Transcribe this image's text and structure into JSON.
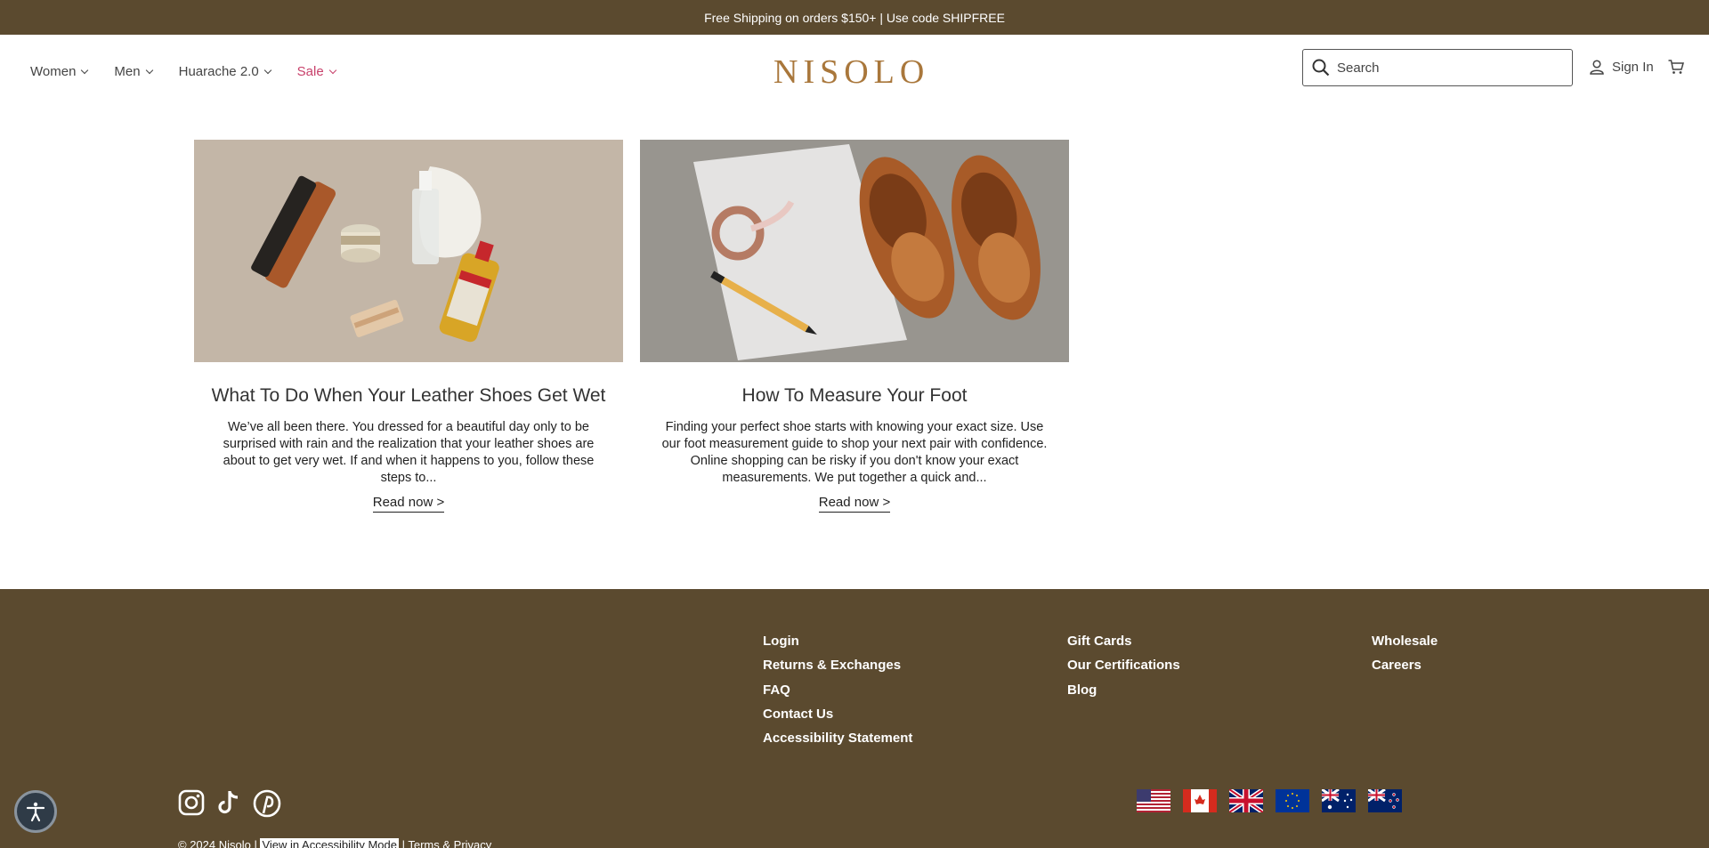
{
  "announcement": "Free Shipping on orders $150+ | Use code SHIPFREE",
  "header": {
    "nav": [
      {
        "label": "Women"
      },
      {
        "label": "Men"
      },
      {
        "label": "Huarache 2.0"
      },
      {
        "label": "Sale"
      }
    ],
    "logo": "NISOLO",
    "search_placeholder": "Search",
    "signin": "Sign In"
  },
  "articles": [
    {
      "title": "What To Do When Your Leather Shoes Get Wet",
      "excerpt": "We’ve all been there. You dressed for a beautiful day only to be surprised with rain and the realization that your leather shoes are about to get very wet. If and when it happens to you, follow these steps to...",
      "cta": "Read now >"
    },
    {
      "title": "How To Measure Your Foot",
      "excerpt": "Finding your perfect shoe starts with knowing your exact size. Use our foot measurement guide to shop your next pair with confidence. Online shopping can be risky if you don't know your exact measurements. We put together a quick and...",
      "cta": "Read now >"
    }
  ],
  "footer": {
    "col1": [
      "Login",
      "Returns & Exchanges",
      "FAQ",
      "Contact Us",
      "Accessibility Statement"
    ],
    "col2": [
      "Gift Cards",
      "Our Certifications",
      "Blog"
    ],
    "col3": [
      "Wholesale",
      "Careers"
    ],
    "copyright": "© 2024 Nisolo",
    "accessibility_link": "View in Accessibility Mode",
    "terms": "Terms & Privacy",
    "social_icons": [
      "instagram-icon",
      "tiktok-icon",
      "pinterest-icon"
    ],
    "flags": [
      "us-flag",
      "canada-flag",
      "uk-flag",
      "eu-flag",
      "australia-flag",
      "new-zealand-flag"
    ]
  },
  "colors": {
    "brand_brown": "#5b4a2f",
    "logo_gold": "#a9773b",
    "sale_pink": "#c8416b"
  }
}
